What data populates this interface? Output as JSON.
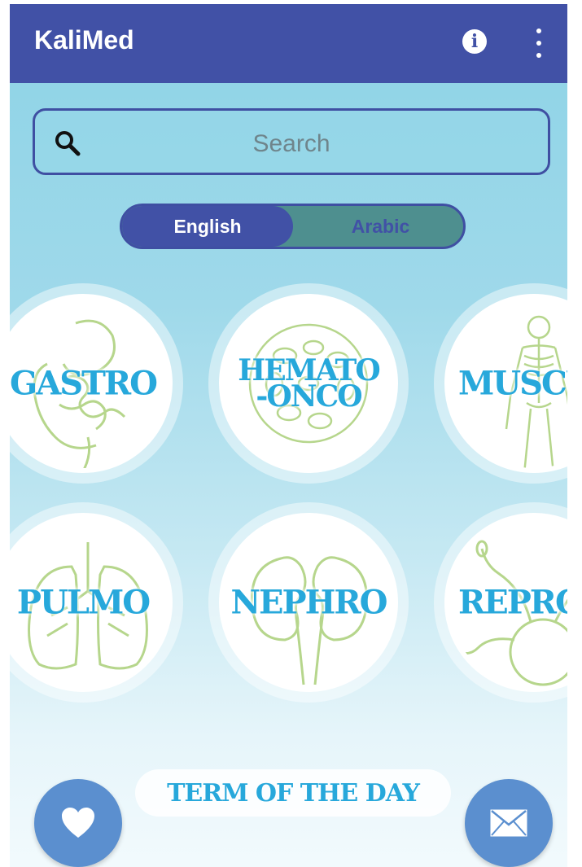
{
  "app": {
    "title": "KaliMed"
  },
  "search": {
    "placeholder": "Search"
  },
  "language": {
    "options": [
      "English",
      "Arabic"
    ],
    "selected": "English"
  },
  "categories": [
    {
      "label": "GASTRO",
      "icon": "digestive-system-icon"
    },
    {
      "label": "HEMATO",
      "label2": "-ONCO",
      "icon": "blood-cells-icon"
    },
    {
      "label": "MUSCU",
      "icon": "skeleton-icon"
    },
    {
      "label": "PULMO",
      "icon": "lungs-icon"
    },
    {
      "label": "NEPHRO",
      "icon": "kidneys-icon"
    },
    {
      "label": "REPRO",
      "icon": "sperm-egg-icon"
    }
  ],
  "term_of_day": {
    "label": "TERM OF THE DAY"
  },
  "colors": {
    "appbar": "#4151a6",
    "label_blue": "#27a8db",
    "fab": "#5b8fcf",
    "art_green": "#b6d68c"
  }
}
